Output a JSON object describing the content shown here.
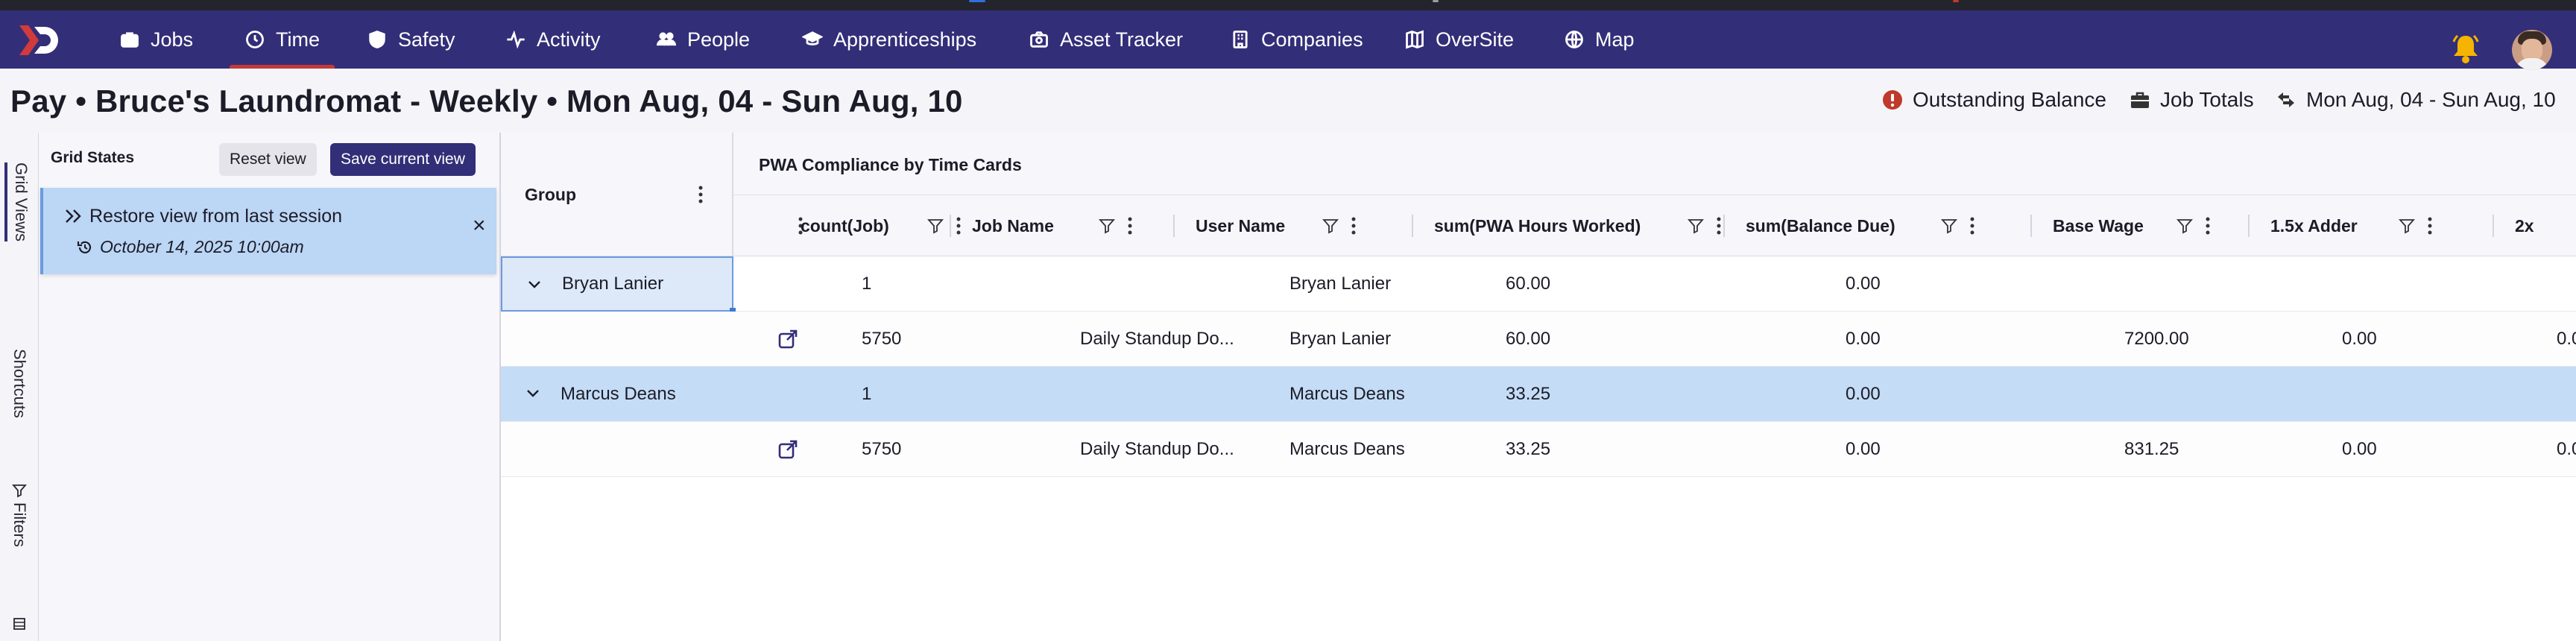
{
  "nav": {
    "items": [
      {
        "label": "Jobs",
        "icon": "briefcase-icon"
      },
      {
        "label": "Time",
        "icon": "clock-icon"
      },
      {
        "label": "Safety",
        "icon": "shield-icon"
      },
      {
        "label": "Activity",
        "icon": "activity-icon"
      },
      {
        "label": "People",
        "icon": "people-icon"
      },
      {
        "label": "Apprenticeships",
        "icon": "graduation-cap-icon"
      },
      {
        "label": "Asset Tracker",
        "icon": "camera-icon"
      },
      {
        "label": "Companies",
        "icon": "building-icon"
      },
      {
        "label": "OverSite",
        "icon": "map-book-icon"
      },
      {
        "label": "Map",
        "icon": "globe-icon"
      }
    ],
    "active": "Time",
    "accent": "#332e78",
    "active_underline": "#c23a3a",
    "bell_color": "#f5b400"
  },
  "page": {
    "title": "Pay • Bruce's Laundromat - Weekly • Mon Aug, 04 - Sun Aug, 10",
    "outstanding_balance": "Outstanding Balance",
    "job_totals": "Job Totals",
    "date_range": "Mon Aug, 04 - Sun Aug, 10"
  },
  "side_tabs": [
    "Grid Views",
    "Shortcuts",
    "Filters"
  ],
  "grid_states": {
    "title": "Grid States",
    "reset_label": "Reset view",
    "save_label": "Save current view",
    "restore_title": "Restore view from last session",
    "restore_time": "October 14, 2025 10:00am"
  },
  "table": {
    "group_header": "Group",
    "group_title": "PWA Compliance by Time Cards",
    "columns": [
      "count(Job)",
      "Job Name",
      "User Name",
      "sum(PWA Hours Worked)",
      "sum(Balance Due)",
      "Base Wage",
      "1.5x Adder",
      "2x"
    ],
    "rows": [
      {
        "type": "group",
        "group": "Bryan Lanier",
        "count": "1",
        "job": "",
        "user": "Bryan Lanier",
        "hours": "60.00",
        "balance": "0.00",
        "wage": "",
        "adder": "",
        "two": ""
      },
      {
        "type": "child",
        "group": "",
        "count": "5750",
        "job": "Daily Standup Do...",
        "user": "Bryan Lanier",
        "hours": "60.00",
        "balance": "0.00",
        "wage": "7200.00",
        "adder": "0.00",
        "two": "0.0"
      },
      {
        "type": "group",
        "group": "Marcus Deans",
        "count": "1",
        "job": "",
        "user": "Marcus Deans",
        "hours": "33.25",
        "balance": "0.00",
        "wage": "",
        "adder": "",
        "two": ""
      },
      {
        "type": "child",
        "group": "",
        "count": "5750",
        "job": "Daily Standup Do...",
        "user": "Marcus Deans",
        "hours": "33.25",
        "balance": "0.00",
        "wage": "831.25",
        "adder": "0.00",
        "two": "0.0"
      }
    ]
  }
}
